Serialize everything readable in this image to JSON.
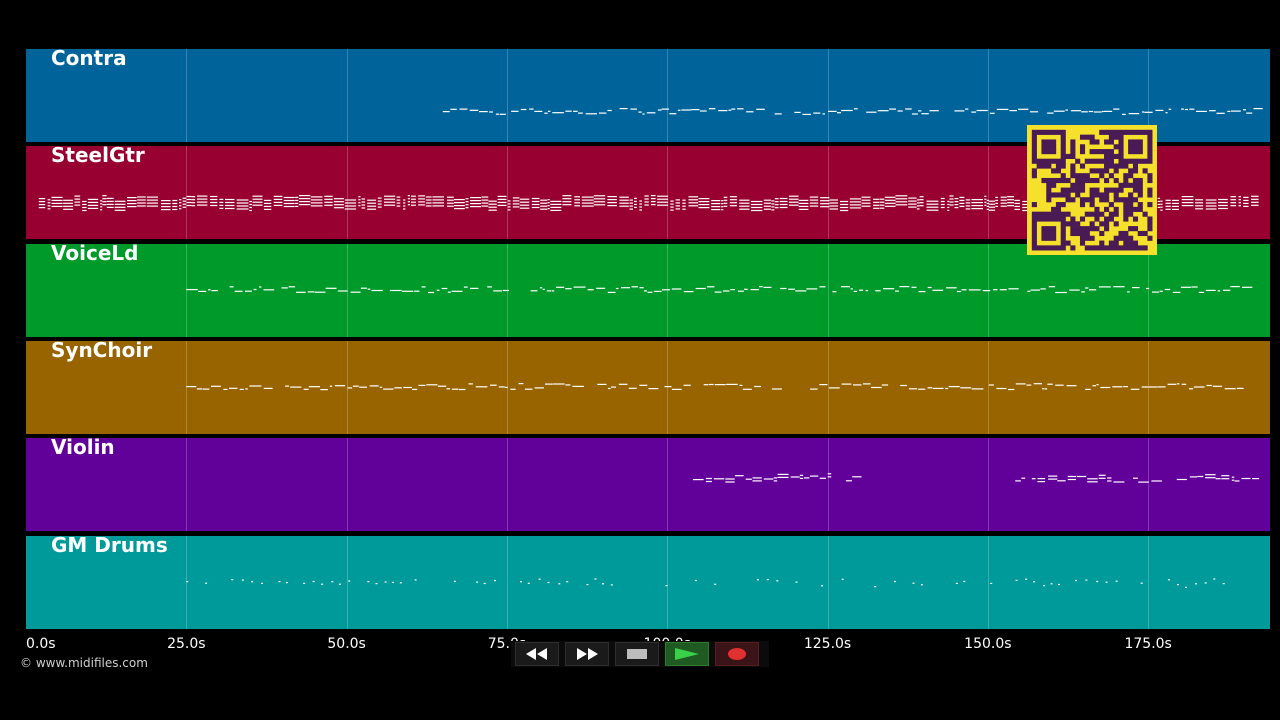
{
  "colors": {
    "background": "#000000",
    "note": "#ffffff",
    "qr_bg": "#f5e12c",
    "qr_fg": "#4a1a55"
  },
  "duration_s": 194,
  "tracks": [
    {
      "name": "Contra",
      "color": "#00649a",
      "note_start_s": 65,
      "note_end_s": 192,
      "density": 0.9,
      "stack": 1,
      "gap": null
    },
    {
      "name": "SteelGtr",
      "color": "#970030",
      "note_start_s": 2,
      "note_end_s": 192,
      "density": 1.0,
      "stack": 4,
      "gap": null
    },
    {
      "name": "VoiceLd",
      "color": "#009a2a",
      "note_start_s": 25,
      "note_end_s": 190,
      "density": 0.9,
      "stack": 1,
      "gap": null
    },
    {
      "name": "SynChoir",
      "color": "#986400",
      "note_start_s": 25,
      "note_end_s": 190,
      "density": 0.9,
      "stack": 1,
      "gap": [
        118,
        122
      ]
    },
    {
      "name": "Violin",
      "color": "#62009a",
      "note_start_s": 104,
      "note_end_s": 192,
      "density": 0.7,
      "stack": 2,
      "gap": [
        130,
        154
      ]
    },
    {
      "name": "GM Drums",
      "color": "#009a9a",
      "note_start_s": 25,
      "note_end_s": 188,
      "density": 0.6,
      "stack": 1,
      "gap": [
        118,
        120
      ]
    }
  ],
  "time_axis": {
    "ticks": [
      {
        "value": 0,
        "label": "0.0s"
      },
      {
        "value": 25,
        "label": "25.0s"
      },
      {
        "value": 50,
        "label": "50.0s"
      },
      {
        "value": 75,
        "label": "75.0s"
      },
      {
        "value": 100,
        "label": "100.0s"
      },
      {
        "value": 125,
        "label": "125.0s"
      },
      {
        "value": 150,
        "label": "150.0s"
      },
      {
        "value": 175,
        "label": "175.0s"
      }
    ]
  },
  "copyright": "© www.midifiles.com",
  "transport": {
    "rewind_icon": "rewind-icon",
    "fastforward_icon": "fast-forward-icon",
    "stop_icon": "stop-icon",
    "play_icon": "play-icon",
    "record_icon": "record-icon"
  },
  "qr_icon": "qr-code-icon"
}
